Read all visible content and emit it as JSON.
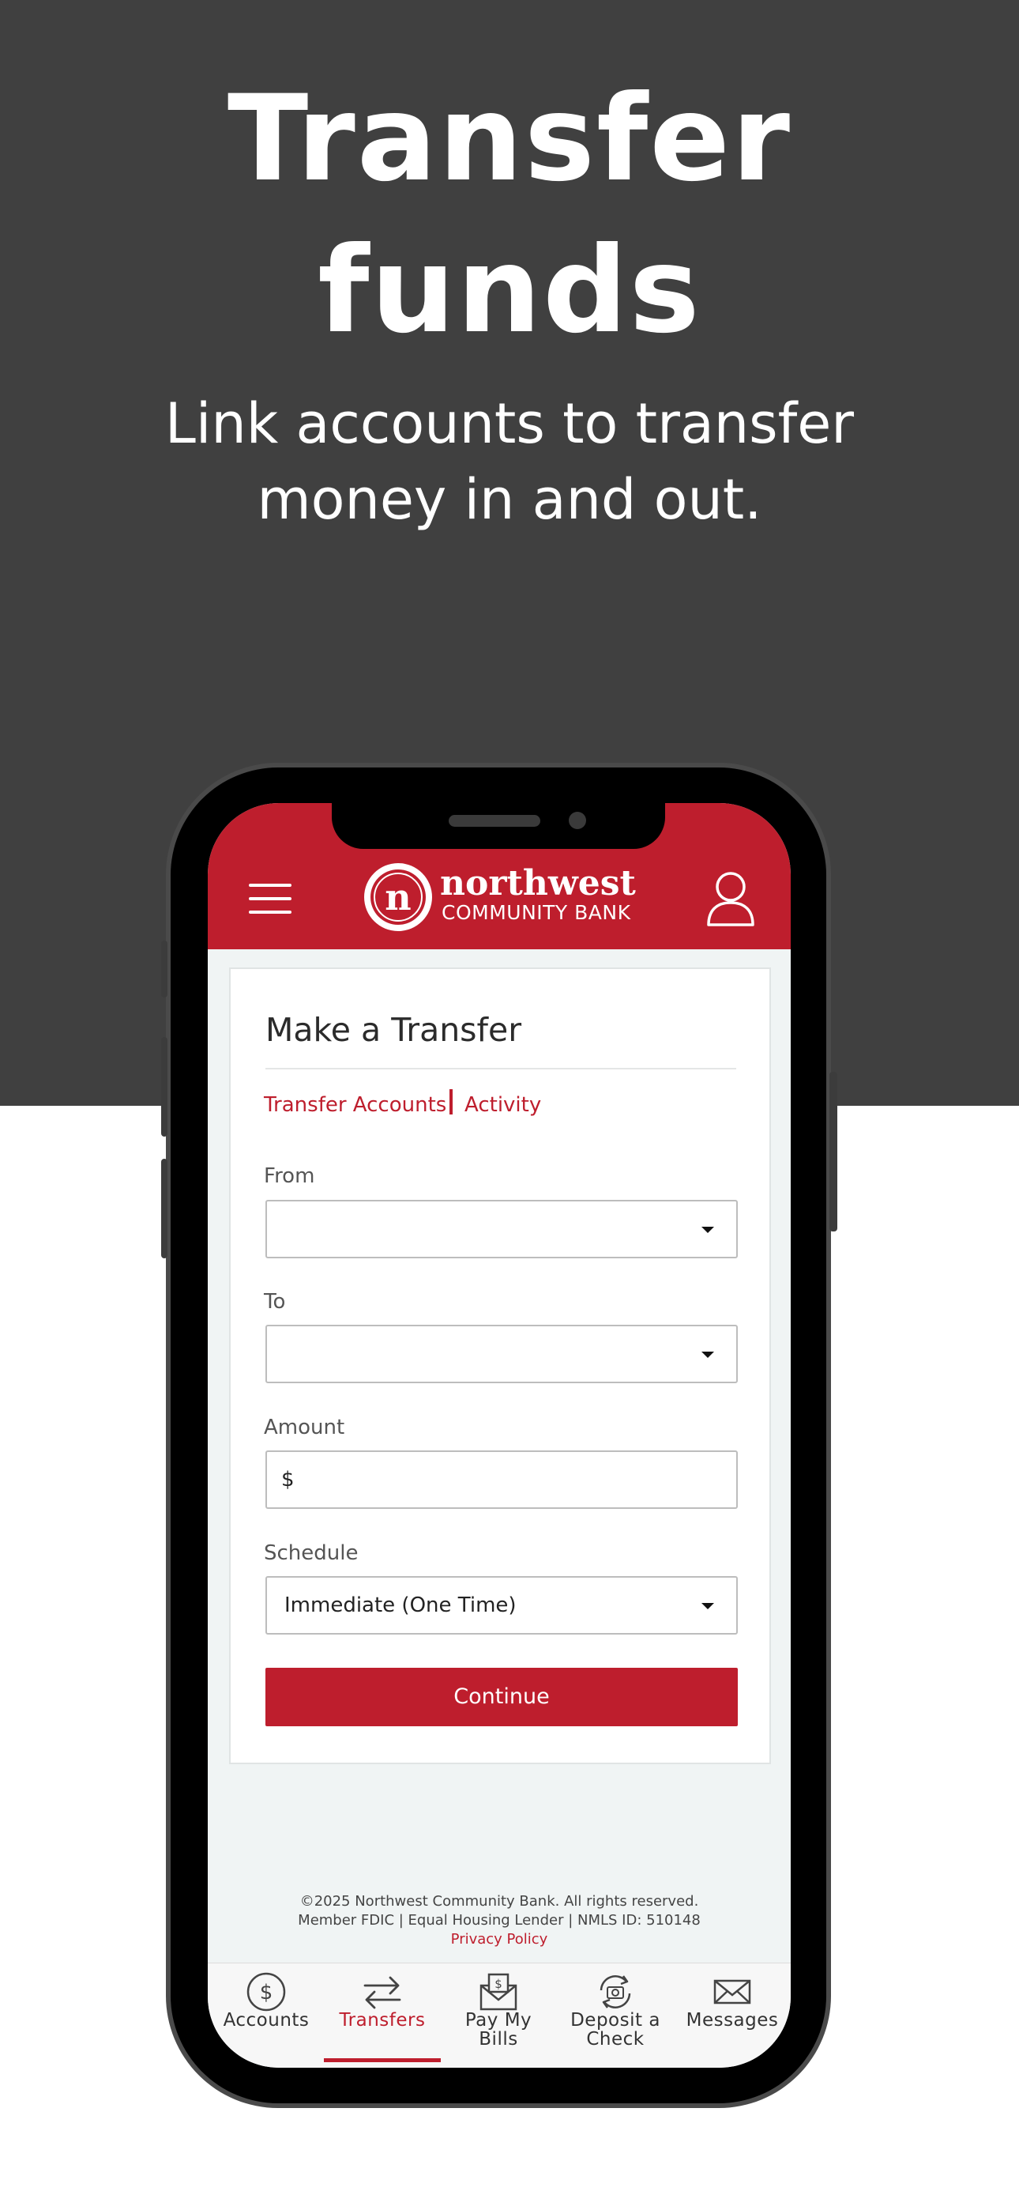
{
  "hero": {
    "title_line1": "Transfer",
    "title_line2": "funds",
    "subtitle_line1": "Link accounts to transfer",
    "subtitle_line2": "money in and out."
  },
  "app": {
    "brand_name": "northwest",
    "brand_sub": "COMMUNITY BANK",
    "logo_letter": "n",
    "accent_color": "#be1e2d"
  },
  "transfer_form": {
    "title": "Make a Transfer",
    "links": {
      "transfer_accounts": "Transfer Accounts",
      "activity": "Activity"
    },
    "from": {
      "label": "From",
      "value": ""
    },
    "to": {
      "label": "To",
      "value": ""
    },
    "amount": {
      "label": "Amount",
      "prefix": "$",
      "value": ""
    },
    "schedule": {
      "label": "Schedule",
      "value": "Immediate (One Time)"
    },
    "continue_label": "Continue"
  },
  "footer": {
    "copyright": "©2025 Northwest Community Bank. All rights reserved.",
    "legal": "Member FDIC | Equal Housing Lender | NMLS ID: 510148",
    "privacy_link": "Privacy Policy"
  },
  "tabbar": {
    "active": "Transfers",
    "tabs": [
      {
        "label": "Accounts",
        "icon": "dollar-circle-icon"
      },
      {
        "label": "Transfers",
        "icon": "transfer-arrows-icon"
      },
      {
        "label_line1": "Pay My",
        "label_line2": "Bills",
        "icon": "envelope-bill-icon"
      },
      {
        "label_line1": "Deposit a",
        "label_line2": "Check",
        "icon": "camera-refresh-icon"
      },
      {
        "label": "Messages",
        "icon": "mail-icon"
      }
    ]
  }
}
